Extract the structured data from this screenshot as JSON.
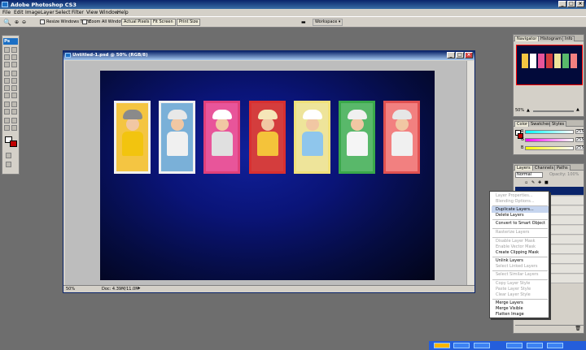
{
  "app": {
    "title": "Adobe Photoshop CS3"
  },
  "menu": [
    "File",
    "Edit",
    "Image",
    "Layer",
    "Select",
    "Filter",
    "View",
    "Window",
    "Help"
  ],
  "options": {
    "resize_windows": "Resize Windows To Fit",
    "zoom_all": "Zoom All Windows",
    "actual_pixels": "Actual Pixels",
    "fit_screen": "Fit Screen",
    "print_size": "Print Size",
    "workspace": "Workspace ▾"
  },
  "toolbox": {
    "logo": "Ps"
  },
  "document": {
    "title": "Untitled-1.psd @ 50% (RGB/8)",
    "zoom": "50%",
    "doc_info": "Doc: 4.39M/11.0M",
    "photos": [
      {
        "frame": "#f0f0f0",
        "bg": "#f4c542",
        "hat": "#8a8a8a",
        "shirt": "#f2c40f"
      },
      {
        "frame": "#f0f0f0",
        "bg": "#7ab0d8",
        "hat": "#e8e8e8",
        "shirt": "#f0f0f0"
      },
      {
        "frame": "#e0407a",
        "bg": "#e8559a",
        "hat": "#ffffff",
        "shirt": "#e0e0e0"
      },
      {
        "frame": "#d83030",
        "bg": "#d43d3d",
        "hat": "#f5e6b8",
        "shirt": "#f4c33a"
      },
      {
        "frame": "#f0e07a",
        "bg": "#eee49a",
        "hat": "#ffffff",
        "shirt": "#8fc6ec"
      },
      {
        "frame": "#3aa84a",
        "bg": "#59b86a",
        "hat": "#f0f0f0",
        "shirt": "#f5f5f5"
      },
      {
        "frame": "#e05050",
        "bg": "#f28080",
        "hat": "#e6e6e6",
        "shirt": "#f0f0f0"
      }
    ]
  },
  "navigator": {
    "tabs": [
      "Navigator",
      "Histogram",
      "Info"
    ],
    "zoom": "50%",
    "thumb_colors": [
      "#f4c542",
      "#ffffff",
      "#e8559a",
      "#d43d3d",
      "#eee49a",
      "#59b86a",
      "#f28080"
    ]
  },
  "color": {
    "tabs": [
      "Color",
      "Swatches",
      "Styles"
    ],
    "rows": [
      {
        "label": "R",
        "value": "255"
      },
      {
        "label": "G",
        "value": "255"
      },
      {
        "label": "B",
        "value": "255"
      }
    ]
  },
  "layers": {
    "tabs": [
      "Layers",
      "Channels",
      "Paths"
    ],
    "blend": "Normal",
    "opacity": "Opacity: 100%"
  },
  "context_menu": {
    "items": [
      {
        "label": "Layer Properties...",
        "enabled": false
      },
      {
        "label": "Blending Options...",
        "enabled": false
      },
      {
        "label": "Duplicate Layers...",
        "enabled": true,
        "highlighted": true
      },
      {
        "label": "Delete Layers",
        "enabled": true
      },
      {
        "label": "Convert to Smart Object",
        "enabled": true
      },
      {
        "label": "Rasterize Layers",
        "enabled": false
      },
      {
        "label": "Disable Layer Mask",
        "enabled": false
      },
      {
        "label": "Enable Vector Mask",
        "enabled": false
      },
      {
        "label": "Create Clipping Mask",
        "enabled": true
      },
      {
        "label": "Unlink Layers",
        "enabled": true
      },
      {
        "label": "Select Linked Layers",
        "enabled": false
      },
      {
        "label": "Select Similar Layers",
        "enabled": false
      },
      {
        "label": "Copy Layer Style",
        "enabled": false
      },
      {
        "label": "Paste Layer Style",
        "enabled": false
      },
      {
        "label": "Clear Layer Style",
        "enabled": false
      },
      {
        "label": "Merge Layers",
        "enabled": true
      },
      {
        "label": "Merge Visible",
        "enabled": true
      },
      {
        "label": "Flatten Image",
        "enabled": true
      }
    ]
  }
}
